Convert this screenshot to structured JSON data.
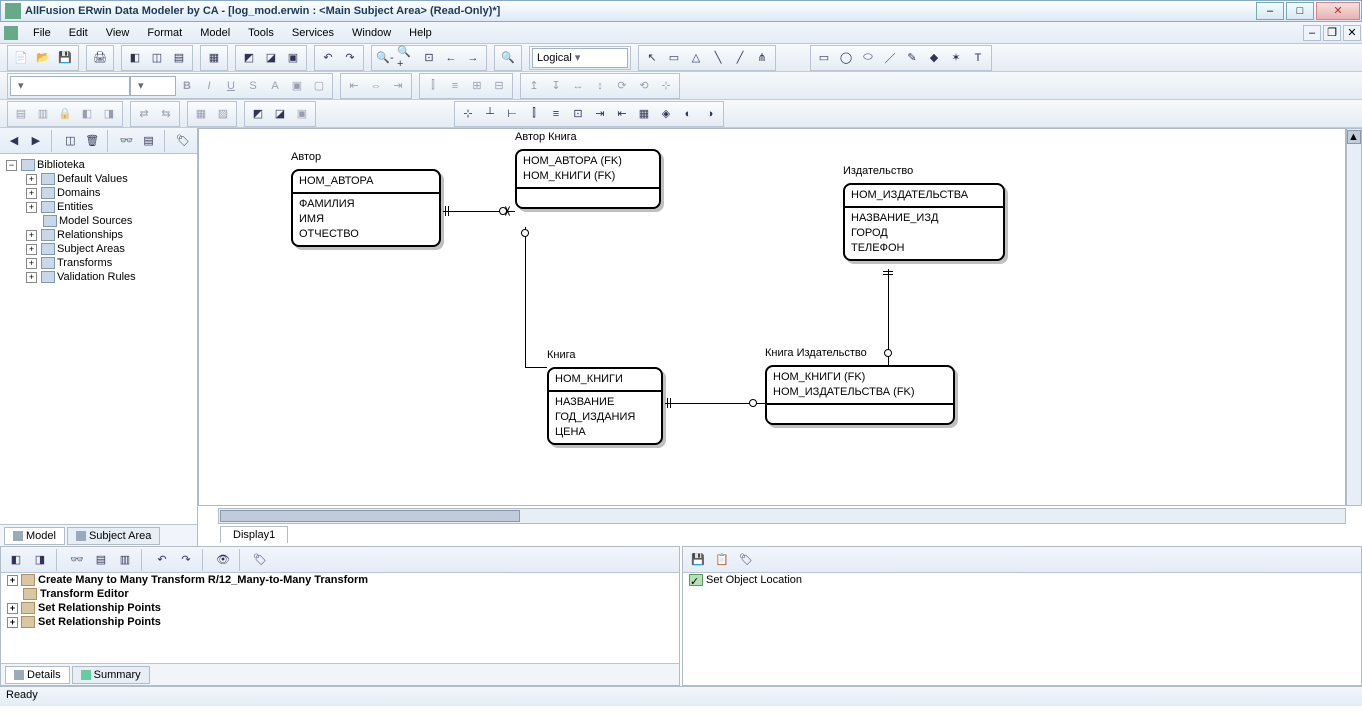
{
  "title": "AllFusion ERwin Data Modeler by CA - [log_mod.erwin : <Main Subject Area> (Read-Only)*]",
  "menu": [
    "File",
    "Edit",
    "View",
    "Format",
    "Model",
    "Tools",
    "Services",
    "Window",
    "Help"
  ],
  "model_type_selected": "Logical",
  "tree": {
    "root": "Biblioteka",
    "items": [
      "Default Values",
      "Domains",
      "Entities",
      "Model Sources",
      "Relationships",
      "Subject Areas",
      "Transforms",
      "Validation Rules"
    ]
  },
  "left_tabs": [
    "Model",
    "Subject Area"
  ],
  "display_tab": "Display1",
  "entities": {
    "avtor": {
      "title": "Автор",
      "pk": [
        "НОМ_АВТОРА"
      ],
      "attrs": [
        "ФАМИЛИЯ",
        "ИМЯ",
        "ОТЧЕСТВО"
      ]
    },
    "avtor_kniga": {
      "title": "Автор Книга",
      "pk": [
        "НОМ_АВТОРА (FK)",
        "НОМ_КНИГИ (FK)"
      ],
      "attrs": []
    },
    "izdatelstvo": {
      "title": "Издательство",
      "pk": [
        "НОМ_ИЗДАТЕЛЬСТВА"
      ],
      "attrs": [
        "НАЗВАНИЕ_ИЗД",
        "ГОРОД",
        "ТЕЛЕФОН"
      ]
    },
    "kniga": {
      "title": "Книга",
      "pk": [
        "НОМ_КНИГИ"
      ],
      "attrs": [
        "НАЗВАНИЕ",
        "ГОД_ИЗДАНИЯ",
        "ЦЕНА"
      ]
    },
    "kniga_izdatelstvo": {
      "title": "Книга Издательство",
      "pk": [
        "НОМ_КНИГИ (FK)",
        "НОМ_ИЗДАТЕЛЬСТВА (FK)"
      ],
      "attrs": []
    }
  },
  "actions": {
    "items": [
      "Create Many to Many Transform R/12_Many-to-Many Transform",
      "Transform Editor",
      "Set Relationship Points",
      "Set Relationship Points"
    ],
    "tabs": [
      "Details",
      "Summary"
    ]
  },
  "advisory": {
    "items": [
      "Set Object Location"
    ]
  },
  "status": "Ready"
}
